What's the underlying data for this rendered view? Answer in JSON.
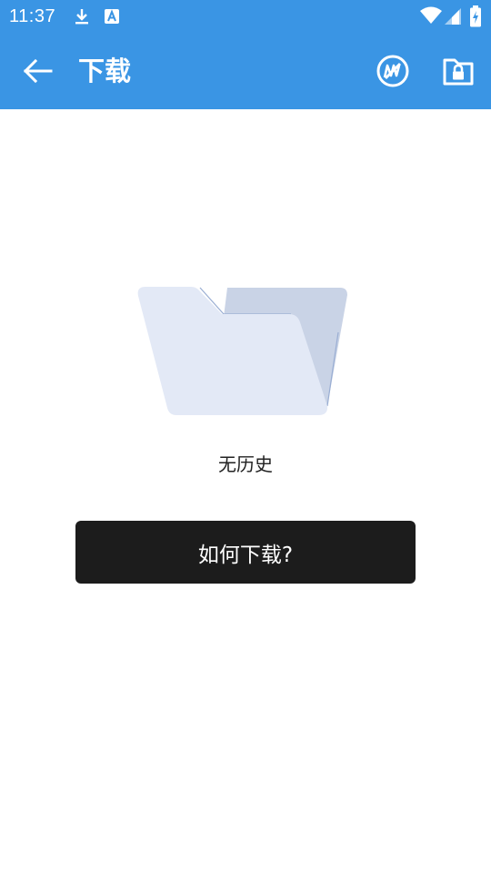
{
  "status_bar": {
    "time": "11:37",
    "icons": [
      "download-icon",
      "a-badge-icon",
      "wifi-icon",
      "signal-icon",
      "battery-charging-icon"
    ]
  },
  "app_bar": {
    "title": "下载",
    "back_icon": "arrow-left-icon",
    "actions": [
      "no-download-icon",
      "private-folder-lock-icon"
    ]
  },
  "empty_state": {
    "icon": "empty-folder-icon",
    "message": "无历史"
  },
  "help_button": {
    "label": "如何下载?"
  },
  "colors": {
    "app_bar": "#3a95e4",
    "button": "#1c1c1c",
    "folder_front": "#e3e9f6",
    "folder_back": "#c9d3e6"
  }
}
